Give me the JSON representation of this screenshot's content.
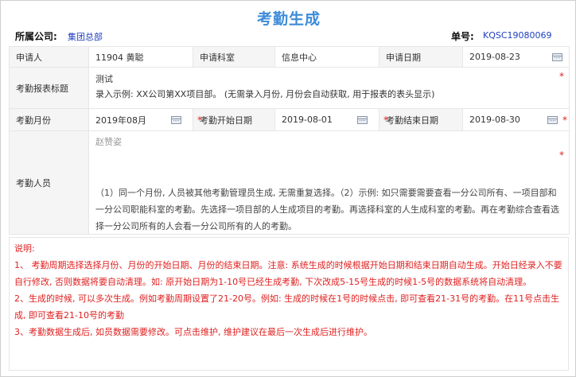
{
  "title": "考勤生成",
  "meta": {
    "company_label": "所属公司:",
    "company_value": "集团总部",
    "doc_no_label": "单号:",
    "doc_no_value": "KQSC19080069"
  },
  "form": {
    "applicant_label": "申请人",
    "applicant_value": "11904 黄聪",
    "dept_label": "申请科室",
    "dept_value": "信息中心",
    "apply_date_label": "申请日期",
    "apply_date_value": "2019-08-23",
    "subject_label": "考勤报表标题",
    "subject_value": "测试",
    "subject_hint": "录入示例: XX公司第XX项目部。 (无需录入月份, 月份会自动获取, 用于报表的表头显示)",
    "month_label": "考勤月份",
    "month_value": "2019年08月",
    "start_label": "考勤开始日期",
    "start_value": "2019-08-01",
    "end_label": "考勤结束日期",
    "end_value": "2019-08-30",
    "person_label": "考勤人员",
    "person_value": "赵赞姿",
    "person_desc": "（1）同一个月份, 人员被其他考勤管理员生成, 无需重复选择。（2）示例: 如只需要需要查看一分公司所有、一项目部和一分公司职能科室的考勤。先选择一项目部的人生成项目的考勤。再选择科室的人生成科室的考勤。再在考勤综合查看选择一分公司所有的人会看一分公司所有的人的考勤。",
    "required_mark": "*"
  },
  "notes": [
    "说明:",
    "1、 考勤周期选择选择月份、月份的开始日期、月份的结束日期。注意: 系统生成的时候根据开始日期和结束日期自动生成。开始日经录入不要自行修改, 否则数据将要自动清理。如: 原开始日期为1-10号已经生成考勤, 下次改成5-15号生成的时候1-5号的数据系统将自动清理。",
    "2、生成的时候, 可以多次生成。例如考勤周期设置了21-20号。例如: 生成的时候在1号的时候点击, 即可查看21-31号的考勤。在11号点击生成, 即可查看21-10号的考勤",
    "3、考勤数据生成后, 如员数据需要修改。可点击维护, 维护建议在最后一次生成后进行维护。"
  ]
}
